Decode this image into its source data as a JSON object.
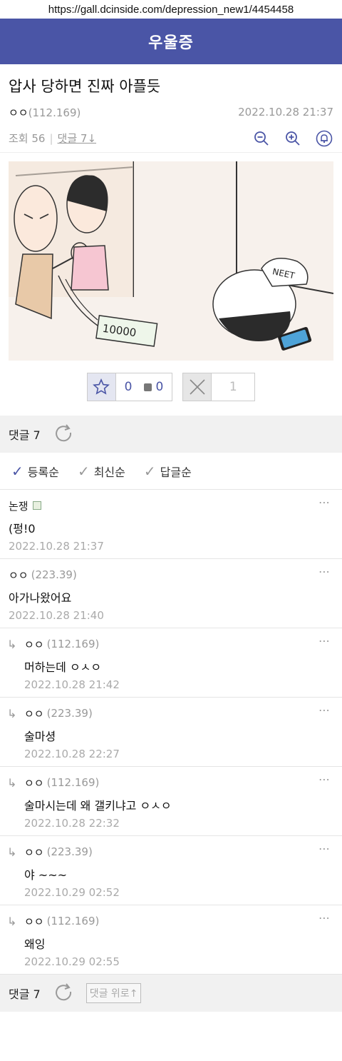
{
  "browser": {
    "url": "https://gall.dcinside.com/depression_new1/4454458"
  },
  "gallery": {
    "name": "우울증"
  },
  "post": {
    "title": "압사 당하면 진짜 아플듯",
    "author": "ㅇㅇ",
    "author_ip": "(112.169)",
    "date": "2022.10.28 21:37",
    "views_label": "조회 56",
    "comments_link": "댓글 7↓",
    "image_text": "10000",
    "image_cap": "NEET"
  },
  "recommend": {
    "up_count": "0",
    "fix_count": "0",
    "down_count": "1"
  },
  "comments_header": {
    "label": "댓글 7"
  },
  "sort_options": [
    {
      "label": "등록순"
    },
    {
      "label": "최신순"
    },
    {
      "label": "답글순"
    }
  ],
  "comments": [
    {
      "name": "논쟁",
      "ip": "",
      "text": "(펑!0",
      "time": "2022.10.28 21:37",
      "reply": false
    },
    {
      "name": "ㅇㅇ",
      "ip": "(223.39)",
      "text": "아가나왔어요",
      "time": "2022.10.28 21:40",
      "reply": false
    },
    {
      "name": "ㅇㅇ",
      "ip": "(112.169)",
      "text": "머하는데 ㅇㅅㅇ",
      "time": "2022.10.28 21:42",
      "reply": true
    },
    {
      "name": "ㅇㅇ",
      "ip": "(223.39)",
      "text": "술마셩",
      "time": "2022.10.28 22:27",
      "reply": true
    },
    {
      "name": "ㅇㅇ",
      "ip": "(112.169)",
      "text": "술마시는데 왜 갤키냐고 ㅇㅅㅇ",
      "time": "2022.10.28 22:32",
      "reply": true
    },
    {
      "name": "ㅇㅇ",
      "ip": "(223.39)",
      "text": "야 ~~~",
      "time": "2022.10.29 02:52",
      "reply": true
    },
    {
      "name": "ㅇㅇ",
      "ip": "(112.169)",
      "text": "왜잉",
      "time": "2022.10.29 02:55",
      "reply": true
    }
  ],
  "comments_footer": {
    "label": "댓글 7",
    "up_button": "댓글 위로↑"
  },
  "icons": {
    "more": "more-dots-icon",
    "reply": "reply-arrow-icon",
    "refresh": "refresh-icon"
  },
  "colors": {
    "brand": "#4a55a6"
  }
}
